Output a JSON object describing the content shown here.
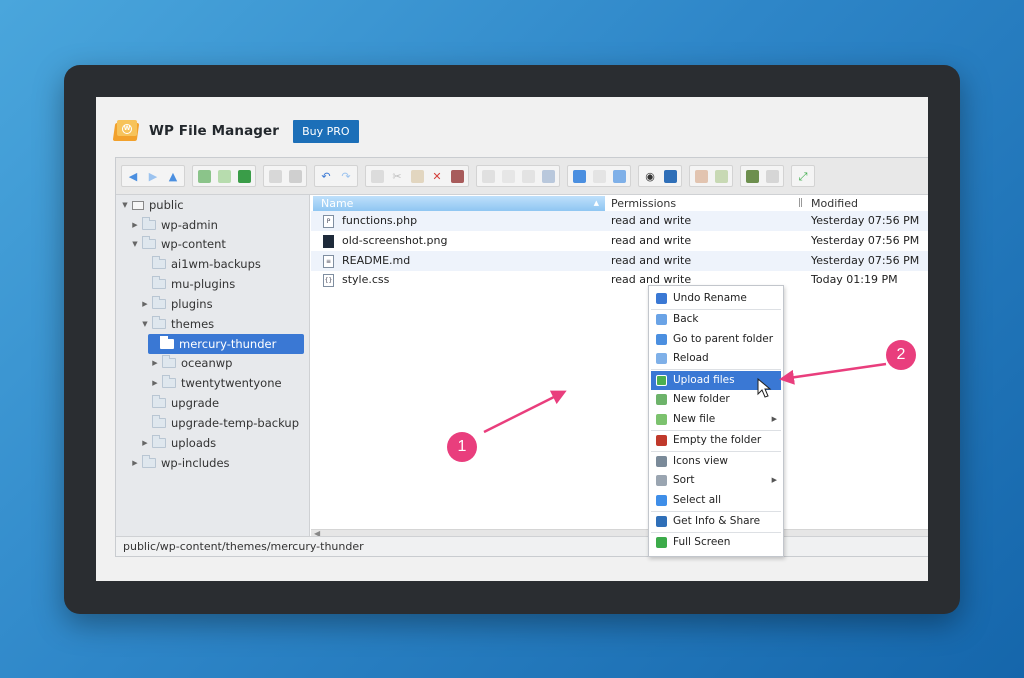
{
  "app": {
    "title": "WP File Manager",
    "buy_label": "Buy PRO"
  },
  "tree": [
    {
      "label": "public",
      "icon": "computer-icon"
    },
    {
      "label": "wp-admin"
    },
    {
      "label": "wp-content"
    },
    {
      "label": "ai1wm-backups"
    },
    {
      "label": "mu-plugins"
    },
    {
      "label": "plugins"
    },
    {
      "label": "themes"
    },
    {
      "label": "mercury-thunder",
      "selected": true
    },
    {
      "label": "oceanwp"
    },
    {
      "label": "twentytwentyone"
    },
    {
      "label": "upgrade"
    },
    {
      "label": "upgrade-temp-backup"
    },
    {
      "label": "uploads"
    },
    {
      "label": "wp-includes"
    }
  ],
  "columns": {
    "name": "Name",
    "permissions": "Permissions",
    "modified": "Modified"
  },
  "files": [
    {
      "name": "functions.php",
      "permissions": "read and write",
      "modified": "Yesterday 07:56 PM",
      "icon": "php-file-icon"
    },
    {
      "name": "old-screenshot.png",
      "permissions": "read and write",
      "modified": "Yesterday 07:56 PM",
      "icon": "image-file-icon"
    },
    {
      "name": "README.md",
      "permissions": "read and write",
      "modified": "Yesterday 07:56 PM",
      "icon": "text-file-icon"
    },
    {
      "name": "style.css",
      "permissions": "read and write",
      "modified": "Today 01:19 PM",
      "icon": "css-file-icon"
    }
  ],
  "status_path": "public/wp-content/themes/mercury-thunder",
  "context_menu": [
    {
      "label": "Undo Rename",
      "icon": "undo-icon",
      "color": "#3a78d4"
    },
    {
      "label": "Back",
      "icon": "back-arrow-icon",
      "color": "#6aa3e6"
    },
    {
      "label": "Go to parent folder",
      "icon": "up-arrow-icon",
      "color": "#4b8fe0"
    },
    {
      "label": "Reload",
      "icon": "reload-icon",
      "color": "#7fb0e8"
    },
    {
      "label": "Upload files",
      "icon": "upload-icon",
      "color": "#4caf50",
      "highlighted": true
    },
    {
      "label": "New folder",
      "icon": "new-folder-icon",
      "color": "#6db36a"
    },
    {
      "label": "New file",
      "icon": "new-file-icon",
      "color": "#7cc26e",
      "submenu": true
    },
    {
      "label": "Empty the folder",
      "icon": "empty-folder-icon",
      "color": "#c0392b"
    },
    {
      "label": "Icons view",
      "icon": "icons-view-icon",
      "color": "#7a8a99"
    },
    {
      "label": "Sort",
      "icon": "sort-icon",
      "color": "#9aa5b1",
      "submenu": true
    },
    {
      "label": "Select all",
      "icon": "select-all-icon",
      "color": "#3f8ee8"
    },
    {
      "label": "Get Info & Share",
      "icon": "info-icon",
      "color": "#2f6fb8"
    },
    {
      "label": "Full Screen",
      "icon": "fullscreen-icon",
      "color": "#3cab4a"
    }
  ],
  "annotations": [
    {
      "label": "1"
    },
    {
      "label": "2"
    }
  ],
  "colors": {
    "accent": "#3a78d4",
    "badge": "#e93e7d",
    "buy_button": "#1c6fb8"
  }
}
